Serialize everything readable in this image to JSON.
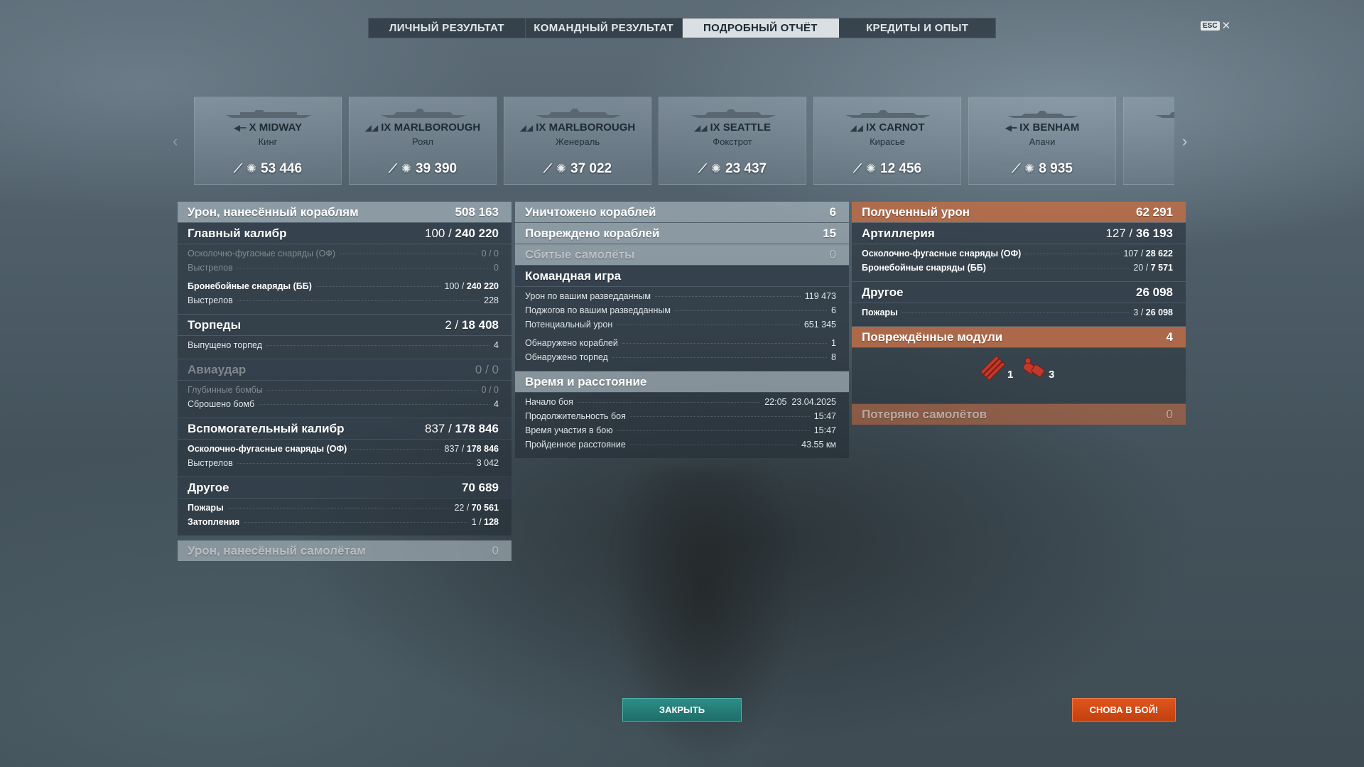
{
  "tabs": [
    {
      "label": "ЛИЧНЫЙ РЕЗУЛЬТАТ"
    },
    {
      "label": "КОМАНДНЫЙ РЕЗУЛЬТАТ"
    },
    {
      "label": "ПОДРОБНЫЙ ОТЧЁТ",
      "active": true
    },
    {
      "label": "КРЕДИТЫ И ОПЫТ"
    }
  ],
  "esc": {
    "key": "ESC",
    "close": "✕"
  },
  "carousel": {
    "prev": "‹",
    "next": "›"
  },
  "ships": [
    {
      "name": "X MIDWAY",
      "player": "Кинг",
      "damage": "53 446"
    },
    {
      "name": "IX MARLBOROUGH",
      "player": "Роял",
      "damage": "39 390"
    },
    {
      "name": "IX MARLBOROUGH",
      "player": "Женераль",
      "damage": "37 022"
    },
    {
      "name": "IX SEATTLE",
      "player": "Фокстрот",
      "damage": "23 437"
    },
    {
      "name": "IX CARNOT",
      "player": "Кирасье",
      "damage": "12 456"
    },
    {
      "name": "IX BENHAM",
      "player": "Апачи",
      "damage": "8 935"
    }
  ],
  "left": {
    "damage_ships": {
      "label": "Урон, нанесённый кораблям",
      "value": "508 163"
    },
    "main": {
      "label": "Главный калибр",
      "hits": "100",
      "total": "240 220"
    },
    "main_he": {
      "label": "Осколочно-фугасные снаряды (ОФ)",
      "value": "0 / 0"
    },
    "main_he_shots": {
      "label": "Выстрелов",
      "value": "0"
    },
    "main_ap": {
      "label": "Бронебойные снаряды (ББ)",
      "hits": "100",
      "total": "240 220"
    },
    "main_ap_shots": {
      "label": "Выстрелов",
      "value": "228"
    },
    "torpedoes": {
      "label": "Торпеды",
      "hits": "2",
      "total": "18 408"
    },
    "torpedoes_fired": {
      "label": "Выпущено торпед",
      "value": "4"
    },
    "airstrike": {
      "label": "Авиаудар",
      "value": "0 / 0"
    },
    "depth_charges": {
      "label": "Глубинные бомбы",
      "value": "0 / 0"
    },
    "bombs_dropped": {
      "label": "Сброшено бомб",
      "value": "4"
    },
    "secondary": {
      "label": "Вспомогательный калибр",
      "hits": "837",
      "total": "178 846"
    },
    "secondary_he": {
      "label": "Осколочно-фугасные снаряды (ОФ)",
      "hits": "837",
      "total": "178 846"
    },
    "secondary_shots": {
      "label": "Выстрелов",
      "value": "3 042"
    },
    "other": {
      "label": "Другое",
      "value": "70 689"
    },
    "fires": {
      "label": "Пожары",
      "hits": "22",
      "total": "70 561"
    },
    "floods": {
      "label": "Затопления",
      "hits": "1",
      "total": "128"
    },
    "damage_planes": {
      "label": "Урон, нанесённый самолётам",
      "value": "0"
    }
  },
  "middle": {
    "destroyed": {
      "label": "Уничтожено кораблей",
      "value": "6"
    },
    "damaged": {
      "label": "Повреждено кораблей",
      "value": "15"
    },
    "planes_shot": {
      "label": "Сбитые самолёты",
      "value": "0"
    },
    "teamplay": {
      "label": "Командная игра"
    },
    "spotting_damage": {
      "label": "Урон по вашим разведданным",
      "value": "119 473"
    },
    "spotting_fires": {
      "label": "Поджогов по вашим разведданным",
      "value": "6"
    },
    "potential": {
      "label": "Потенциальный урон",
      "value": "651 345"
    },
    "ships_spotted": {
      "label": "Обнаружено кораблей",
      "value": "1"
    },
    "torps_spotted": {
      "label": "Обнаружено торпед",
      "value": "8"
    },
    "time_dist": {
      "label": "Время и расстояние"
    },
    "battle_start": {
      "label": "Начало боя",
      "value": "22:05  23.04.2025"
    },
    "duration": {
      "label": "Продолжительность боя",
      "value": "15:47"
    },
    "participation": {
      "label": "Время участия в бою",
      "value": "15:47"
    },
    "distance": {
      "label": "Пройденное расстояние",
      "value": "43.55 км"
    }
  },
  "right": {
    "received": {
      "label": "Полученный урон",
      "value": "62 291"
    },
    "artillery": {
      "label": "Артиллерия",
      "hits": "127",
      "total": "36 193"
    },
    "he": {
      "label": "Осколочно-фугасные снаряды (ОФ)",
      "hits": "107",
      "total": "28 622"
    },
    "ap": {
      "label": "Бронебойные снаряды (ББ)",
      "hits": "20",
      "total": "7 571"
    },
    "other": {
      "label": "Другое",
      "value": "26 098"
    },
    "fires": {
      "label": "Пожары",
      "hits": "3",
      "total": "26 098"
    },
    "modules": {
      "label": "Повреждённые модули",
      "value": "4",
      "items": [
        {
          "icon": "torpedo-tubes-icon",
          "count": "1"
        },
        {
          "icon": "engine-icon",
          "count": "3"
        }
      ],
      "color": "#c0392b"
    },
    "planes_lost": {
      "label": "Потеряно самолётов",
      "value": "0"
    }
  },
  "buttons": {
    "close": "ЗАКРЫТЬ",
    "again": "СНОВА В БОЙ!"
  },
  "colors": {
    "accent_teal": "#2e8c87",
    "accent_orange": "#d9501a",
    "received_header": "#c86e42"
  }
}
